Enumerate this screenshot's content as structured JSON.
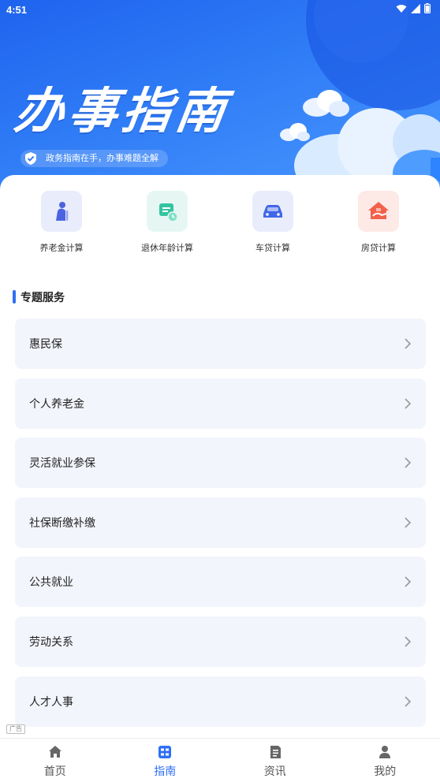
{
  "status_bar": {
    "time": "4:51"
  },
  "banner": {
    "title": "办事指南",
    "tagline": "政务指南在手，办事难题全解"
  },
  "quick_tools": [
    {
      "label": "养老金计算",
      "icon": "elderly-person-icon",
      "bg": "#e9ecfb",
      "color": "#4b63e0"
    },
    {
      "label": "退休年龄计算",
      "icon": "retirement-clock-icon",
      "bg": "#e6f7f3",
      "color": "#34c4a0"
    },
    {
      "label": "车贷计算",
      "icon": "car-icon",
      "bg": "#e9ecfb",
      "color": "#3f67e8"
    },
    {
      "label": "房贷计算",
      "icon": "house-loan-icon",
      "bg": "#fde9e6",
      "color": "#f2614a"
    }
  ],
  "section": {
    "title": "专题服务"
  },
  "services": [
    {
      "label": "惠民保"
    },
    {
      "label": "个人养老金"
    },
    {
      "label": "灵活就业参保"
    },
    {
      "label": "社保断缴补缴"
    },
    {
      "label": "公共就业"
    },
    {
      "label": "劳动关系"
    },
    {
      "label": "人才人事"
    }
  ],
  "ad_label": "广告",
  "tabs": [
    {
      "label": "首页",
      "icon": "home-icon",
      "active": false
    },
    {
      "label": "指南",
      "icon": "guide-icon",
      "active": true
    },
    {
      "label": "资讯",
      "icon": "news-icon",
      "active": false
    },
    {
      "label": "我的",
      "icon": "profile-icon",
      "active": false
    }
  ],
  "colors": {
    "accent": "#2f6ff5",
    "banner_start": "#1e63ee",
    "banner_end": "#4a98ff",
    "card_bg": "#f3f5fc"
  }
}
